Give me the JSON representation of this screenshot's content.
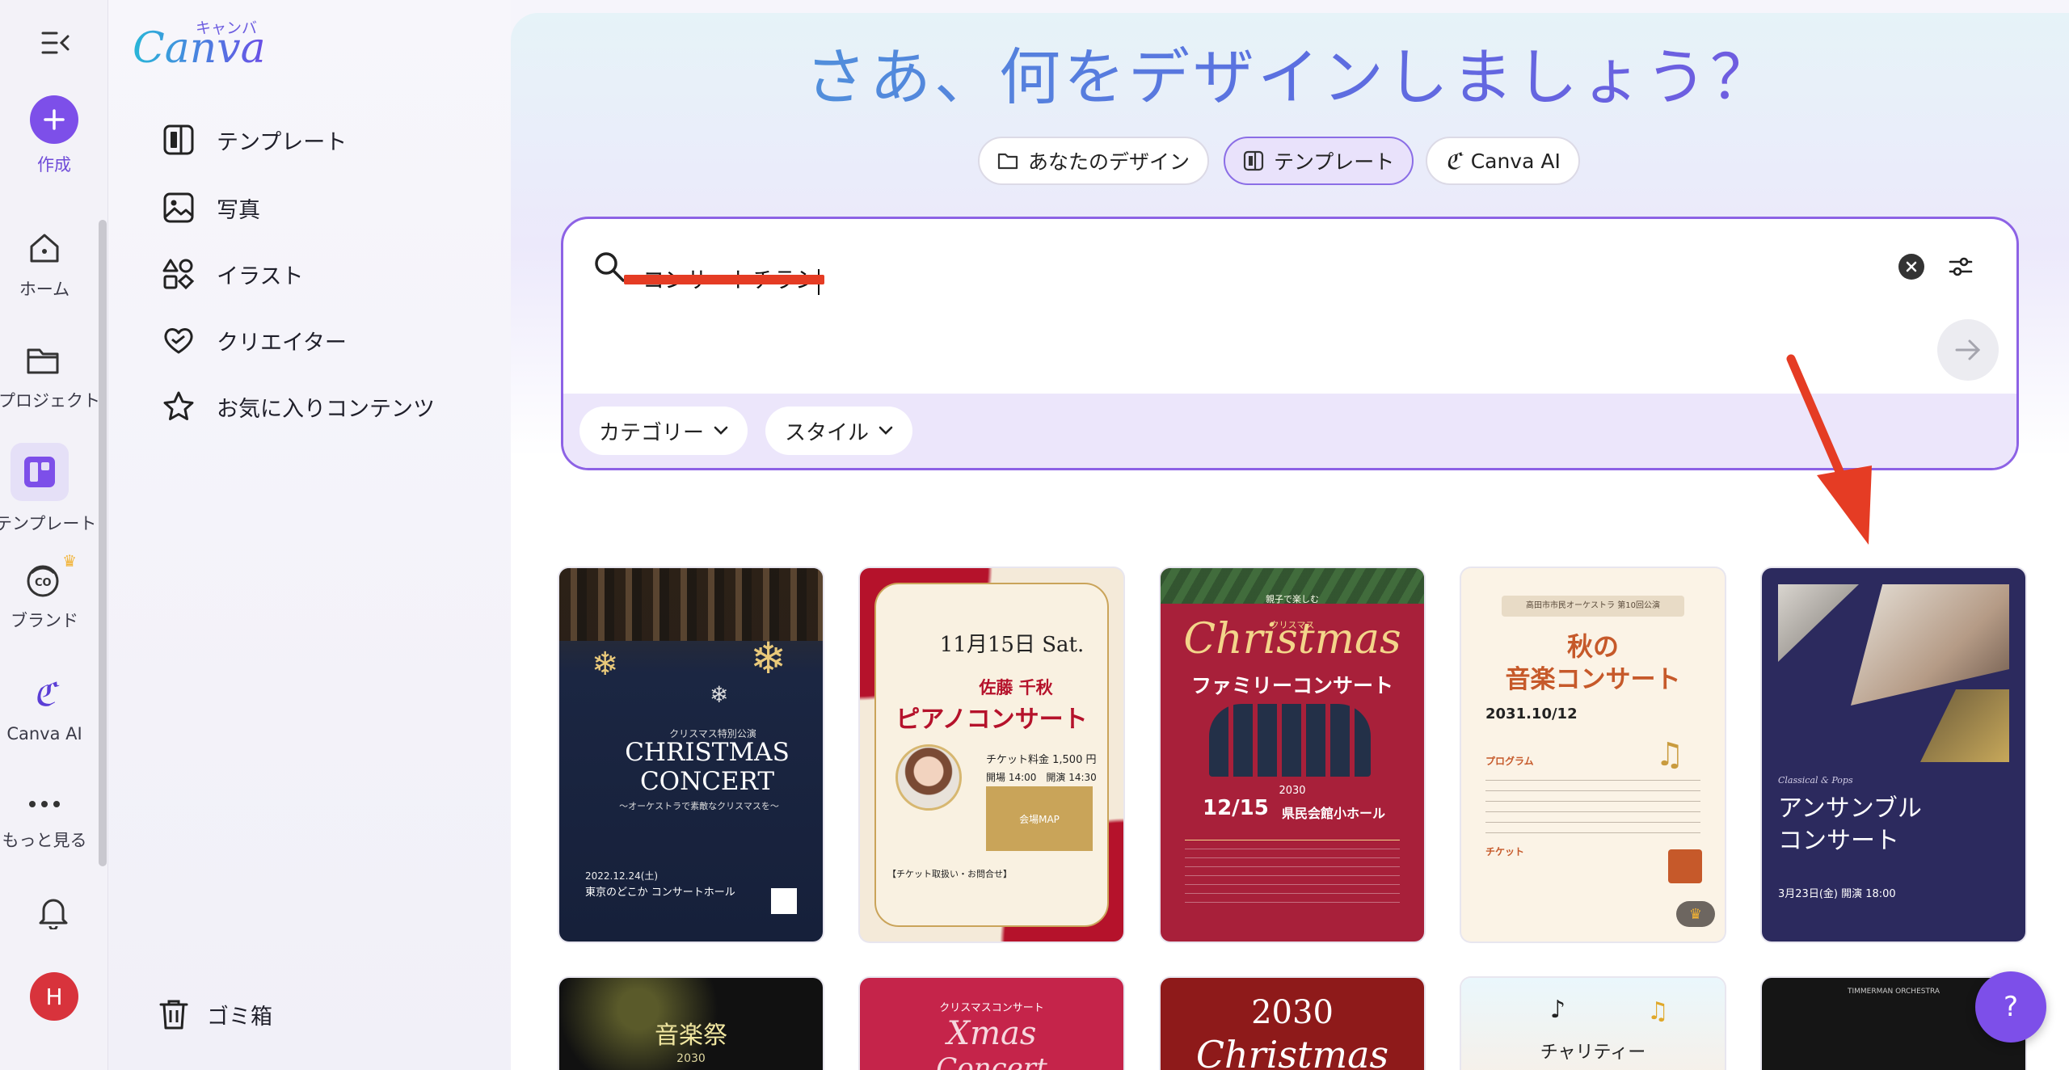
{
  "rail": {
    "create": "作成",
    "home": "ホーム",
    "projects": "プロジェクト",
    "templates": "テンプレート",
    "brand": "ブランド",
    "canva_ai": "Canva AI",
    "more": "もっと見る",
    "avatar": "H"
  },
  "logo": {
    "wordmark": "Canva",
    "kana": "キャンバ"
  },
  "sidebar": {
    "items": [
      {
        "label": "テンプレート",
        "icon": "template-icon"
      },
      {
        "label": "写真",
        "icon": "photo-icon"
      },
      {
        "label": "イラスト",
        "icon": "shapes-icon"
      },
      {
        "label": "クリエイター",
        "icon": "creator-heart-icon"
      },
      {
        "label": "お気に入りコンテンツ",
        "icon": "star-icon"
      }
    ],
    "trash": "ゴミ箱"
  },
  "main": {
    "title": "さあ、何をデザインしましょう？",
    "tabs": [
      {
        "label": "あなたのデザイン",
        "active": false
      },
      {
        "label": "テンプレート",
        "active": true
      },
      {
        "label": "Canva AI",
        "active": false
      }
    ],
    "search": {
      "value": "コンサートチラシ",
      "filters": [
        "カテゴリー",
        "スタイル"
      ]
    }
  },
  "cards": [
    {
      "lines": [
        "クリスマス特別公演",
        "CHRISTMAS",
        "CONCERT",
        "〜オーケストラで素敵なクリスマスを〜",
        "2022.12.24(土)",
        "東京のどこか コンサートホール"
      ]
    },
    {
      "lines": [
        "11月15日 Sat.",
        "佐藤 千秋",
        "ピアノコンサート",
        "チケット料金 1,500 円",
        "開場 14:00　開演 14:30",
        "会場MAP",
        "【チケット取扱い・お問合せ】"
      ]
    },
    {
      "lines": [
        "親子で楽しむ",
        "クリスマス",
        "Christmas",
        "ファミリーコンサート",
        "2030",
        "12/15",
        "県民会館小ホール"
      ]
    },
    {
      "lines": [
        "高田市市民オーケストラ 第10回公演",
        "秋の",
        "音楽コンサート",
        "2031.10/12",
        "プログラム",
        "チケット"
      ]
    },
    {
      "lines": [
        "Classical & Pops",
        "アンサンブル",
        "コンサート",
        "3月23日(金) 開演 18:00"
      ]
    }
  ],
  "cards_row2": [
    {
      "lines": [
        "音楽祭",
        "2030"
      ]
    },
    {
      "lines": [
        "クリスマスコンサート",
        "Xmas",
        "Concert"
      ]
    },
    {
      "lines": [
        "2030",
        "Christmas"
      ]
    },
    {
      "lines": [
        "チャリティー"
      ]
    },
    {
      "lines": [
        "TIMMERMAN ORCHESTRA"
      ]
    }
  ],
  "help": "?",
  "colors": {
    "accent": "#8b3dff",
    "annotation_red": "#e53c24"
  }
}
